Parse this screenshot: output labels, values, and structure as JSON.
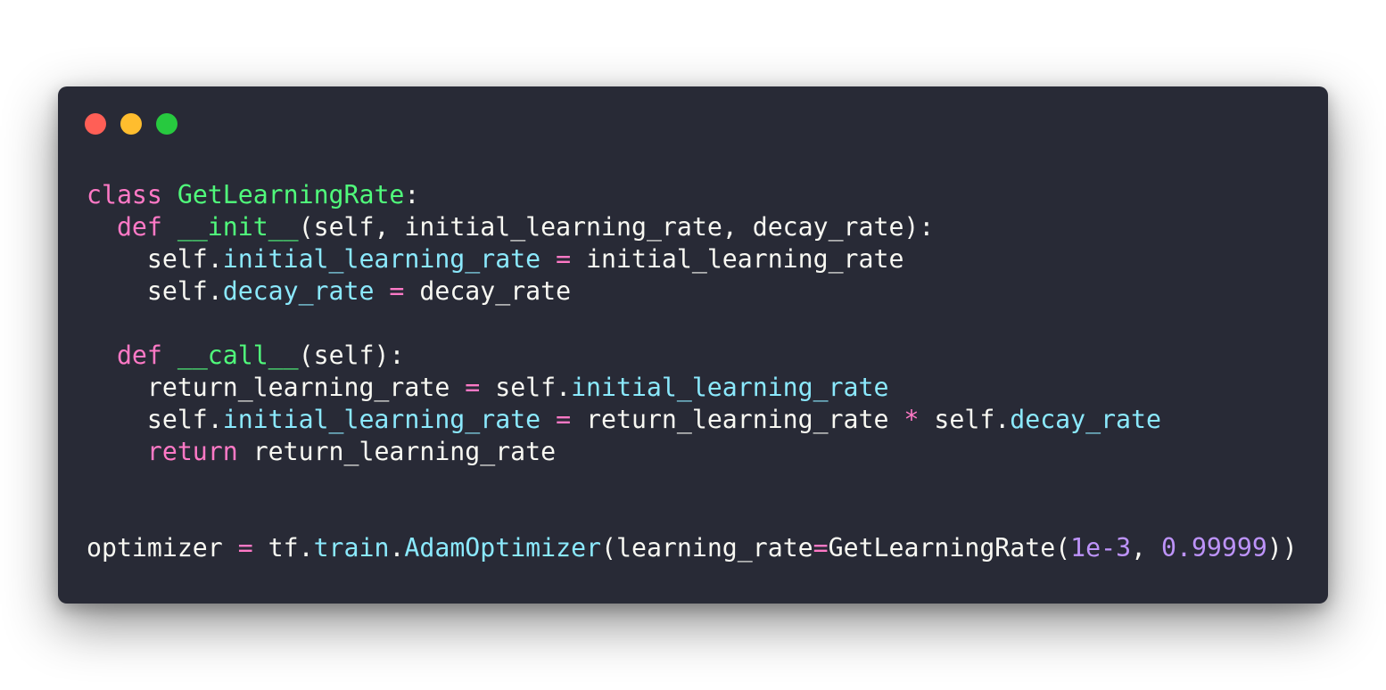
{
  "colors": {
    "background": "#282a36",
    "close": "#ff5f56",
    "minimize": "#ffbd2e",
    "maximize": "#27c93f",
    "text": "#f8f8f2",
    "keyword": "#ff79c6",
    "func": "#50fa7b",
    "attr": "#8be9fd",
    "number": "#bd93f9"
  },
  "window_controls": [
    "close-icon",
    "minimize-icon",
    "maximize-icon"
  ],
  "code_lines": [
    [
      [
        "keyword",
        "class"
      ],
      [
        "text",
        " "
      ],
      [
        "func",
        "GetLearningRate"
      ],
      [
        "text",
        ":"
      ]
    ],
    [
      [
        "text",
        "  "
      ],
      [
        "keyword",
        "def"
      ],
      [
        "text",
        " "
      ],
      [
        "func",
        "__init__"
      ],
      [
        "text",
        "(self, initial_learning_rate, decay_rate):"
      ]
    ],
    [
      [
        "text",
        "    self."
      ],
      [
        "attr",
        "initial_learning_rate"
      ],
      [
        "text",
        " "
      ],
      [
        "keyword",
        "="
      ],
      [
        "text",
        " initial_learning_rate"
      ]
    ],
    [
      [
        "text",
        "    self."
      ],
      [
        "attr",
        "decay_rate"
      ],
      [
        "text",
        " "
      ],
      [
        "keyword",
        "="
      ],
      [
        "text",
        " decay_rate"
      ]
    ],
    [],
    [
      [
        "text",
        "  "
      ],
      [
        "keyword",
        "def"
      ],
      [
        "text",
        " "
      ],
      [
        "func",
        "__call__"
      ],
      [
        "text",
        "(self):"
      ]
    ],
    [
      [
        "text",
        "    return_learning_rate "
      ],
      [
        "keyword",
        "="
      ],
      [
        "text",
        " self."
      ],
      [
        "attr",
        "initial_learning_rate"
      ]
    ],
    [
      [
        "text",
        "    self."
      ],
      [
        "attr",
        "initial_learning_rate"
      ],
      [
        "text",
        " "
      ],
      [
        "keyword",
        "="
      ],
      [
        "text",
        " return_learning_rate "
      ],
      [
        "keyword",
        "*"
      ],
      [
        "text",
        " self."
      ],
      [
        "attr",
        "decay_rate"
      ]
    ],
    [
      [
        "text",
        "    "
      ],
      [
        "keyword",
        "return"
      ],
      [
        "text",
        " return_learning_rate"
      ]
    ],
    [],
    [],
    [
      [
        "text",
        "optimizer "
      ],
      [
        "keyword",
        "="
      ],
      [
        "text",
        " tf."
      ],
      [
        "attr",
        "train"
      ],
      [
        "text",
        "."
      ],
      [
        "attr",
        "AdamOptimizer"
      ],
      [
        "text",
        "(learning_rate"
      ],
      [
        "keyword",
        "="
      ],
      [
        "text",
        "GetLearningRate("
      ],
      [
        "number",
        "1e-3"
      ],
      [
        "text",
        ", "
      ],
      [
        "number",
        "0.99999"
      ],
      [
        "text",
        "))"
      ]
    ]
  ]
}
